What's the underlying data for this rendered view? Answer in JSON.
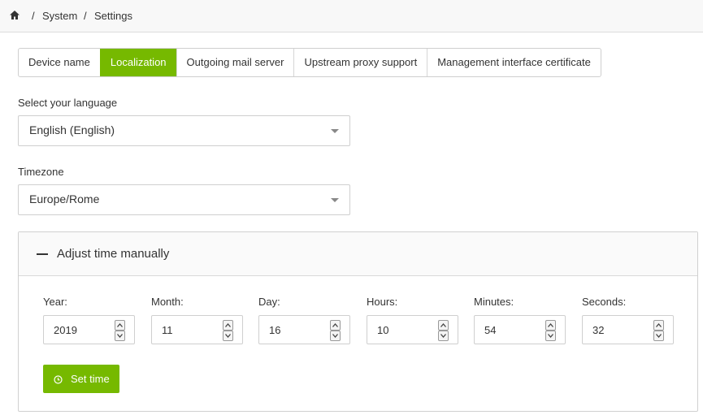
{
  "breadcrumb": {
    "home_icon": "home-icon",
    "sep1": "/",
    "system": "System",
    "sep2": "/",
    "settings": "Settings"
  },
  "tabs": [
    {
      "label": "Device name",
      "active": false
    },
    {
      "label": "Localization",
      "active": true
    },
    {
      "label": "Outgoing mail server",
      "active": false
    },
    {
      "label": "Upstream proxy support",
      "active": false
    },
    {
      "label": "Management interface certificate",
      "active": false
    }
  ],
  "language": {
    "label": "Select your language",
    "value": "English (English)"
  },
  "timezone": {
    "label": "Timezone",
    "value": "Europe/Rome"
  },
  "manual_time": {
    "toggle_icon": "minus-icon",
    "title": "Adjust time manually",
    "fields": [
      {
        "label": "Year:",
        "value": "2019"
      },
      {
        "label": "Month:",
        "value": "11"
      },
      {
        "label": "Day:",
        "value": "16"
      },
      {
        "label": "Hours:",
        "value": "10"
      },
      {
        "label": "Minutes:",
        "value": "54"
      },
      {
        "label": "Seconds:",
        "value": "32"
      }
    ],
    "set_button": {
      "label": "Set time",
      "icon": "clock-icon"
    }
  },
  "colors": {
    "accent": "#76b900",
    "border": "#cfcfcf",
    "text": "#333333"
  }
}
